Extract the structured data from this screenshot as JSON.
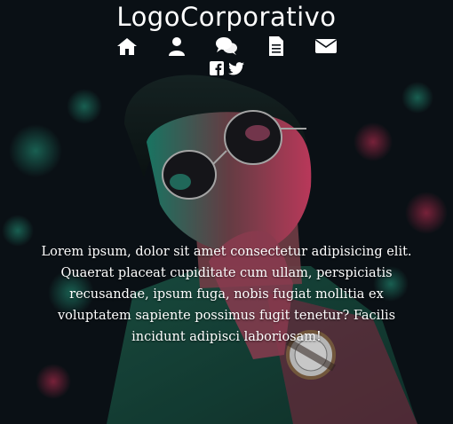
{
  "header": {
    "logo_text": "LogoCorporativo"
  },
  "nav": {
    "items": [
      {
        "icon": "home-icon"
      },
      {
        "icon": "user-icon"
      },
      {
        "icon": "comments-icon"
      },
      {
        "icon": "document-icon"
      },
      {
        "icon": "envelope-icon"
      }
    ]
  },
  "social": {
    "items": [
      {
        "icon": "facebook-icon"
      },
      {
        "icon": "twitter-icon"
      }
    ]
  },
  "hero": {
    "text": "Lorem ipsum, dolor sit amet consectetur adipisicing elit. Quaerat placeat cupiditate cum ullam, perspiciatis recusandae, ipsum fuga, nobis fugiat mollitia ex voluptatem sapiente possimus fugit tenetur? Facilis incidunt adipisci laboriosam!"
  },
  "colors": {
    "text": "#ffffff",
    "background": "#0b1016",
    "accent_teal": "#1fb38a",
    "accent_red": "#e0306a"
  }
}
